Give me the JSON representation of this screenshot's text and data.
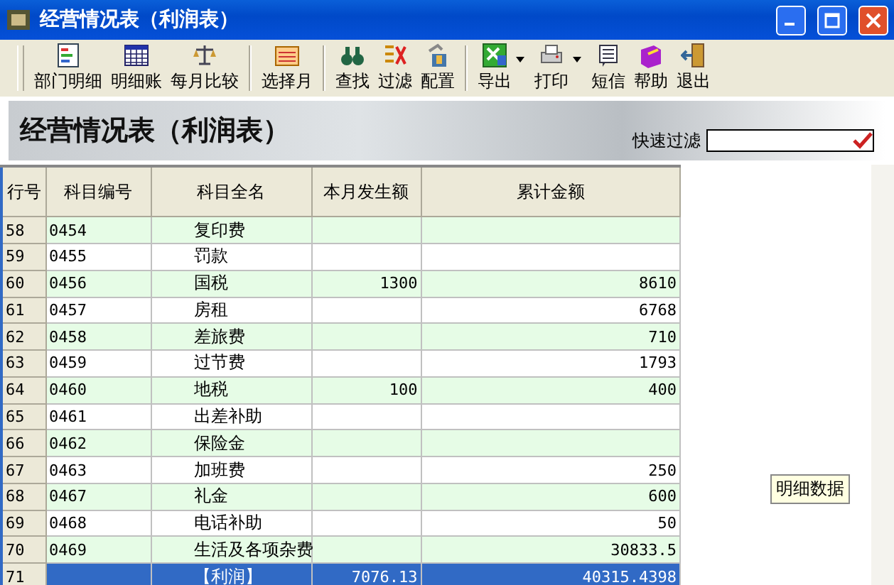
{
  "window": {
    "title": "经营情况表（利润表）"
  },
  "toolbar": [
    [
      {
        "label": "部门明细",
        "dropdown": false
      },
      {
        "label": "明细账",
        "dropdown": false
      },
      {
        "label": "每月比较",
        "dropdown": false
      }
    ],
    [
      {
        "label": "选择月",
        "dropdown": false
      }
    ],
    [
      {
        "label": "查找",
        "dropdown": false
      },
      {
        "label": "过滤",
        "dropdown": false
      },
      {
        "label": "配置",
        "dropdown": false
      }
    ],
    [
      {
        "label": "导出",
        "dropdown": true
      },
      {
        "label": "打印",
        "dropdown": true
      },
      {
        "label": "短信",
        "dropdown": false
      },
      {
        "label": "帮助",
        "dropdown": false
      },
      {
        "label": "退出",
        "dropdown": false
      }
    ]
  ],
  "banner": {
    "title": "经营情况表（利润表）",
    "filter_label": "快速过滤"
  },
  "table": {
    "columns": [
      "行号",
      "科目编号",
      "科目全名",
      "本月发生额",
      "累计金额"
    ],
    "rows": [
      {
        "cells": [
          "58",
          "0454",
          "复印费",
          "",
          ""
        ],
        "selected": false
      },
      {
        "cells": [
          "59",
          "0455",
          "罚款",
          "",
          ""
        ],
        "selected": false
      },
      {
        "cells": [
          "60",
          "0456",
          "国税",
          "1300",
          "8610"
        ],
        "selected": false
      },
      {
        "cells": [
          "61",
          "0457",
          "房租",
          "",
          "6768"
        ],
        "selected": false
      },
      {
        "cells": [
          "62",
          "0458",
          "差旅费",
          "",
          "710"
        ],
        "selected": false
      },
      {
        "cells": [
          "63",
          "0459",
          "过节费",
          "",
          "1793"
        ],
        "selected": false
      },
      {
        "cells": [
          "64",
          "0460",
          "地税",
          "100",
          "400"
        ],
        "selected": false
      },
      {
        "cells": [
          "65",
          "0461",
          "出差补助",
          "",
          ""
        ],
        "selected": false
      },
      {
        "cells": [
          "66",
          "0462",
          "保险金",
          "",
          ""
        ],
        "selected": false
      },
      {
        "cells": [
          "67",
          "0463",
          "加班费",
          "",
          "250"
        ],
        "selected": false
      },
      {
        "cells": [
          "68",
          "0467",
          "礼金",
          "",
          "600"
        ],
        "selected": false
      },
      {
        "cells": [
          "69",
          "0468",
          "电话补助",
          "",
          "50"
        ],
        "selected": false
      },
      {
        "cells": [
          "70",
          "0469",
          "生活及各项杂费",
          "",
          "30833.5"
        ],
        "selected": false
      },
      {
        "cells": [
          "71",
          "",
          "【利润】",
          "7076.13",
          "40315.4398"
        ],
        "selected": true
      }
    ]
  },
  "tooltip": "明细数据"
}
